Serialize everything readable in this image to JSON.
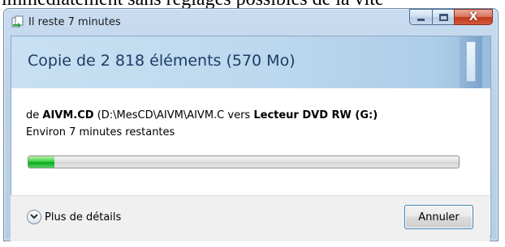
{
  "background": {
    "caption_fragment": "immédiatement sans réglages possibles de la vite"
  },
  "window": {
    "title": "Il reste 7 minutes",
    "title_icon": "file-copy-icon",
    "caption": {
      "minimize": "minimize-icon",
      "maximize": "maximize-icon",
      "close": "X"
    }
  },
  "header": {
    "title": "Copie de 2 818 éléments (570 Mo)"
  },
  "details": {
    "prefix": "de ",
    "source_name": "AIVM.CD",
    "source_path": " (D:\\MesCD\\AIVM\\AIVM.C",
    "middle": " vers ",
    "destination": "Lecteur DVD RW (G:)",
    "remaining": "Environ 7 minutes restantes"
  },
  "progress": {
    "fraction": 0.06,
    "color": "#2cc43a"
  },
  "footer": {
    "more_details": "Plus de détails",
    "cancel": "Annuler"
  },
  "colors": {
    "header_text": "#1e3b66",
    "frame": "#bcd2ea",
    "close_red": "#c2391c"
  }
}
